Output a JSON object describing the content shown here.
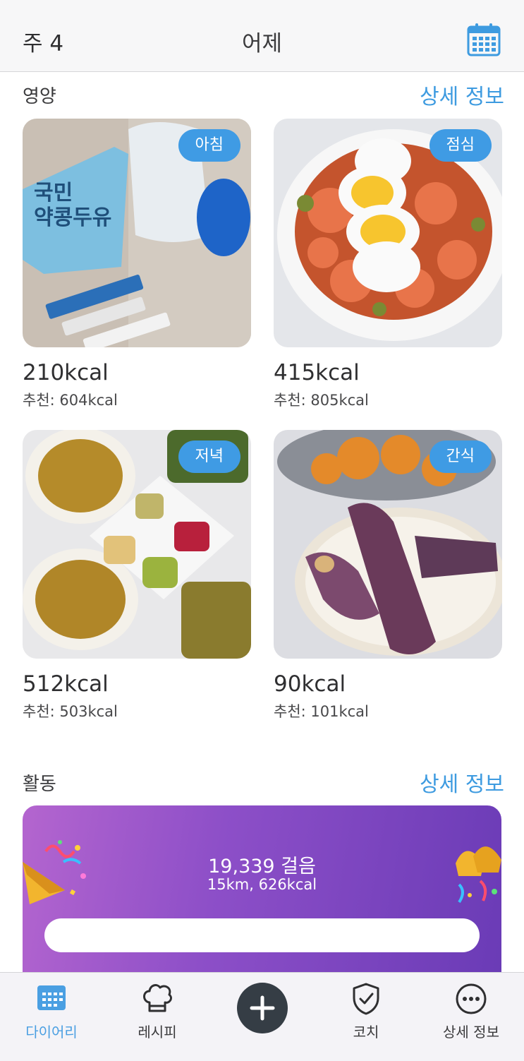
{
  "header": {
    "week": "주 4",
    "title": "어제",
    "calendar_icon": "calendar-icon"
  },
  "nutrition": {
    "title": "영양",
    "detail_link": "상세 정보",
    "meals": [
      {
        "badge": "아침",
        "kcal": "210kcal",
        "recommended": "추천: 604kcal"
      },
      {
        "badge": "점심",
        "kcal": "415kcal",
        "recommended": "추천: 805kcal"
      },
      {
        "badge": "저녁",
        "kcal": "512kcal",
        "recommended": "추천: 503kcal"
      },
      {
        "badge": "간식",
        "kcal": "90kcal",
        "recommended": "추천: 101kcal"
      }
    ]
  },
  "activity": {
    "title": "활동",
    "detail_link": "상세 정보",
    "steps": "19,339 걸음",
    "summary": "15km, 626kcal"
  },
  "tabbar": {
    "items": [
      {
        "label": "다이어리",
        "icon": "calendar-icon",
        "active": true
      },
      {
        "label": "레시피",
        "icon": "chef-hat-icon",
        "active": false
      },
      {
        "label": "코치",
        "icon": "shield-check-icon",
        "active": false
      },
      {
        "label": "상세 정보",
        "icon": "more-icon",
        "active": false
      }
    ],
    "add_icon": "plus-icon"
  },
  "colors": {
    "accent": "#3e9be0",
    "badge": "#3f9be4",
    "activity_start": "#b465cf",
    "activity_end": "#6a3bb6",
    "fab": "#353d45"
  }
}
